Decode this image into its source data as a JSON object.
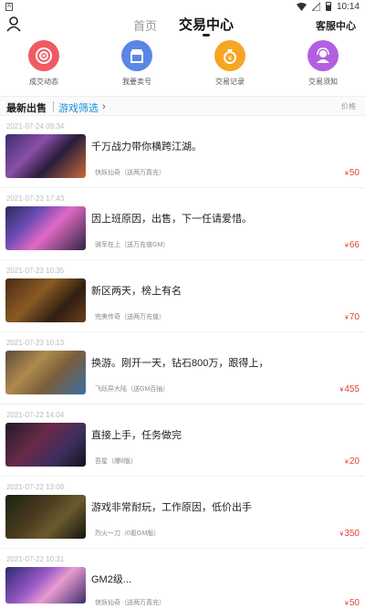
{
  "status_bar": {
    "left_icon": "A",
    "time": "10:14"
  },
  "header": {
    "tab_home": "首页",
    "tab_trade": "交易中心",
    "service": "客服中心"
  },
  "quick_actions": [
    {
      "label": "成交动态",
      "icon": "target-icon",
      "color": "#ef5a63"
    },
    {
      "label": "我要卖号",
      "icon": "store-icon",
      "color": "#5a86e6"
    },
    {
      "label": "交易记录",
      "icon": "money-bag-icon",
      "color": "#f5a623"
    },
    {
      "label": "交易须知",
      "icon": "support-agent-icon",
      "color": "#b35fe0"
    }
  ],
  "filter_bar": {
    "latest": "最新出售",
    "filter": "游戏筛选",
    "price": "价格"
  },
  "listings": [
    {
      "date": "2021-07-24 09:34",
      "title": "千万战力带你横跨江湖。",
      "game": "快妖仙奇（送两万真充）",
      "currency": "¥",
      "price": "50"
    },
    {
      "date": "2021-07-23 17:43",
      "title": "因上班原因，出售，下一任请爱惜。",
      "game": "骑军在上（送万充值GM）",
      "currency": "¥",
      "price": "66"
    },
    {
      "date": "2021-07-23 10:35",
      "title": "新区两天，榜上有名",
      "game": "完美传奇（送两万充值）",
      "currency": "¥",
      "price": "70"
    },
    {
      "date": "2021-07-23 10:13",
      "title": "换游。刚开一天，钻石800万，跟得上，",
      "game": "飞跃异大陆（送GM百抽）",
      "currency": "¥",
      "price": "455"
    },
    {
      "date": "2021-07-22 14:04",
      "title": "直接上手，任务做完",
      "game": "吾星（爆8版）",
      "currency": "¥",
      "price": "20"
    },
    {
      "date": "2021-07-22 13:08",
      "title": "游戏非常耐玩，工作原因，低价出手",
      "game": "烈火一刀（0氪GM版）",
      "currency": "¥",
      "price": "350"
    },
    {
      "date": "2021-07-22 10:31",
      "title": "GM2级...",
      "game": "侠妖仙奇（送两万真充）",
      "currency": "¥",
      "price": "50"
    }
  ]
}
